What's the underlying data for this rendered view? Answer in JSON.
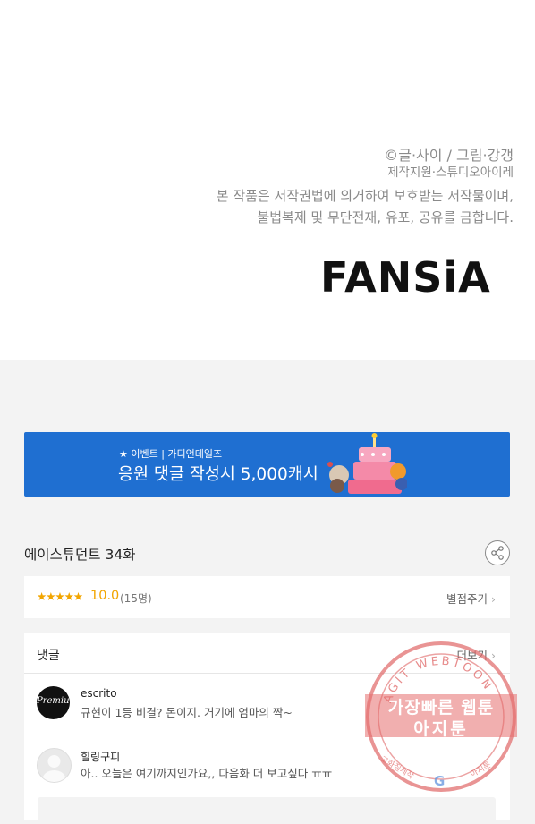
{
  "credits": {
    "line1": "©글·사이 / 그림·강갱",
    "line2": "제작지원·스튜디오아이레",
    "notice_line1": "본 작품은 저작권법에 의거하여 보호받는 저작물이며,",
    "notice_line2": "불법복제 및 무단전재, 유포, 공유를 금합니다."
  },
  "logo": {
    "text": "FANSiA"
  },
  "banner": {
    "small": "★ 이벤트 | 가디언데일즈",
    "big": "응원 댓글 작성시 5,000캐시"
  },
  "episode": {
    "title": "에이스튜던트 34화"
  },
  "rating": {
    "stars": "★★★★★",
    "score": "10.0",
    "count": "(15명)",
    "rate_label": "별점주기",
    "chevron": "›"
  },
  "comments": {
    "header": "댓글",
    "more_label": "더보기",
    "chevron": "›",
    "items": [
      {
        "avatar_text": "Premium",
        "user": "escrito",
        "text": "규현이 1등 비결? 돈이지. 거기에 엄마의 짝~"
      },
      {
        "avatar_text": "",
        "user": "힐링구피",
        "text": "아.. 오늘은 여기까지인가요,, 다음화 더 보고싶다 ㅠㅠ"
      }
    ]
  },
  "watermark": {
    "arc_text": "AGIT WEBTOON",
    "line1": "가장빠른 웹툰",
    "line2": "아지툰",
    "left_small": "고화질제작",
    "right_small": "아지툰",
    "bottom_letter": "G"
  },
  "colors": {
    "banner": "#1f6fd1",
    "star": "#f2a500",
    "stamp": "#e06666"
  },
  "icons": {
    "share": "share-icon",
    "chevron": "chevron-right-icon",
    "avatar": "avatar-icon"
  }
}
